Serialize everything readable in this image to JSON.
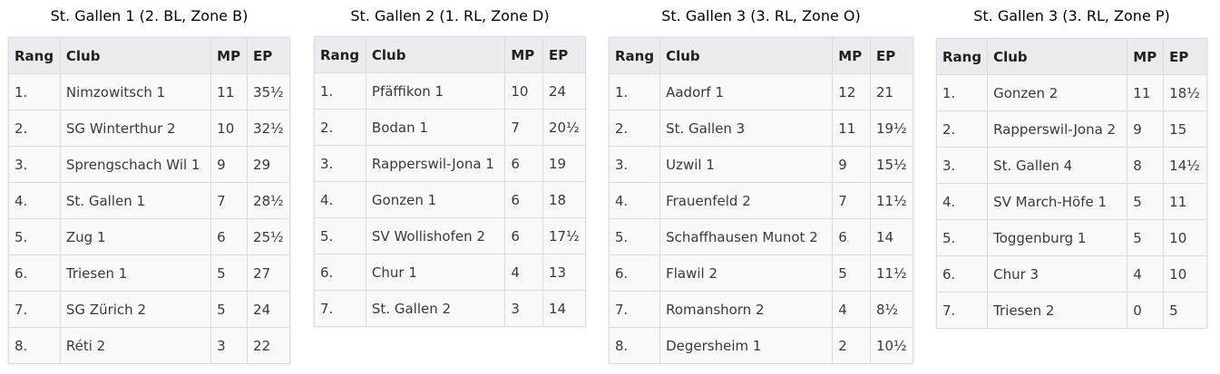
{
  "headers": {
    "rank": "Rang",
    "club": "Club",
    "mp": "MP",
    "ep": "EP"
  },
  "tables": [
    {
      "title": "St. Gallen 1 (2. BL, Zone B)",
      "rows": [
        [
          "1.",
          "Nimzowitsch 1",
          "11",
          "35½"
        ],
        [
          "2.",
          "SG Winterthur 2",
          "10",
          "32½"
        ],
        [
          "3.",
          "Sprengschach Wil 1",
          "9",
          "29"
        ],
        [
          "4.",
          "St. Gallen 1",
          "7",
          "28½"
        ],
        [
          "5.",
          "Zug 1",
          "6",
          "25½"
        ],
        [
          "6.",
          "Triesen 1",
          "5",
          "27"
        ],
        [
          "7.",
          "SG Zürich 2",
          "5",
          "24"
        ],
        [
          "8.",
          "Réti 2",
          "3",
          "22"
        ]
      ]
    },
    {
      "title": "St. Gallen 2 (1. RL, Zone D)",
      "rows": [
        [
          "1.",
          "Pfäffikon 1",
          "10",
          "24"
        ],
        [
          "2.",
          "Bodan 1",
          "7",
          "20½"
        ],
        [
          "3.",
          "Rapperswil-Jona 1",
          "6",
          "19"
        ],
        [
          "4.",
          "Gonzen 1",
          "6",
          "18"
        ],
        [
          "5.",
          "SV Wollishofen 2",
          "6",
          "17½"
        ],
        [
          "6.",
          "Chur 1",
          "4",
          "13"
        ],
        [
          "7.",
          "St. Gallen 2",
          "3",
          "14"
        ]
      ]
    },
    {
      "title": "St. Gallen 3 (3. RL, Zone O)",
      "rows": [
        [
          "1.",
          "Aadorf 1",
          "12",
          "21"
        ],
        [
          "2.",
          "St. Gallen 3",
          "11",
          "19½"
        ],
        [
          "3.",
          "Uzwil 1",
          "9",
          "15½"
        ],
        [
          "4.",
          "Frauenfeld 2",
          "7",
          "11½"
        ],
        [
          "5.",
          "Schaffhausen Munot 2",
          "6",
          "14"
        ],
        [
          "6.",
          "Flawil 2",
          "5",
          "11½"
        ],
        [
          "7.",
          "Romanshorn 2",
          "4",
          "8½"
        ],
        [
          "8.",
          "Degersheim 1",
          "2",
          "10½"
        ]
      ]
    },
    {
      "title": "St. Gallen 3 (3. RL, Zone P)",
      "rows": [
        [
          "1.",
          "Gonzen 2",
          "11",
          "18½"
        ],
        [
          "2.",
          "Rapperswil-Jona 2",
          "9",
          "15"
        ],
        [
          "3.",
          "St. Gallen 4",
          "8",
          "14½"
        ],
        [
          "4.",
          "SV March-Höfe 1",
          "5",
          "11"
        ],
        [
          "5.",
          "Toggenburg 1",
          "5",
          "10"
        ],
        [
          "6.",
          "Chur 3",
          "4",
          "10"
        ],
        [
          "7.",
          "Triesen 2",
          "0",
          "5"
        ]
      ]
    }
  ]
}
